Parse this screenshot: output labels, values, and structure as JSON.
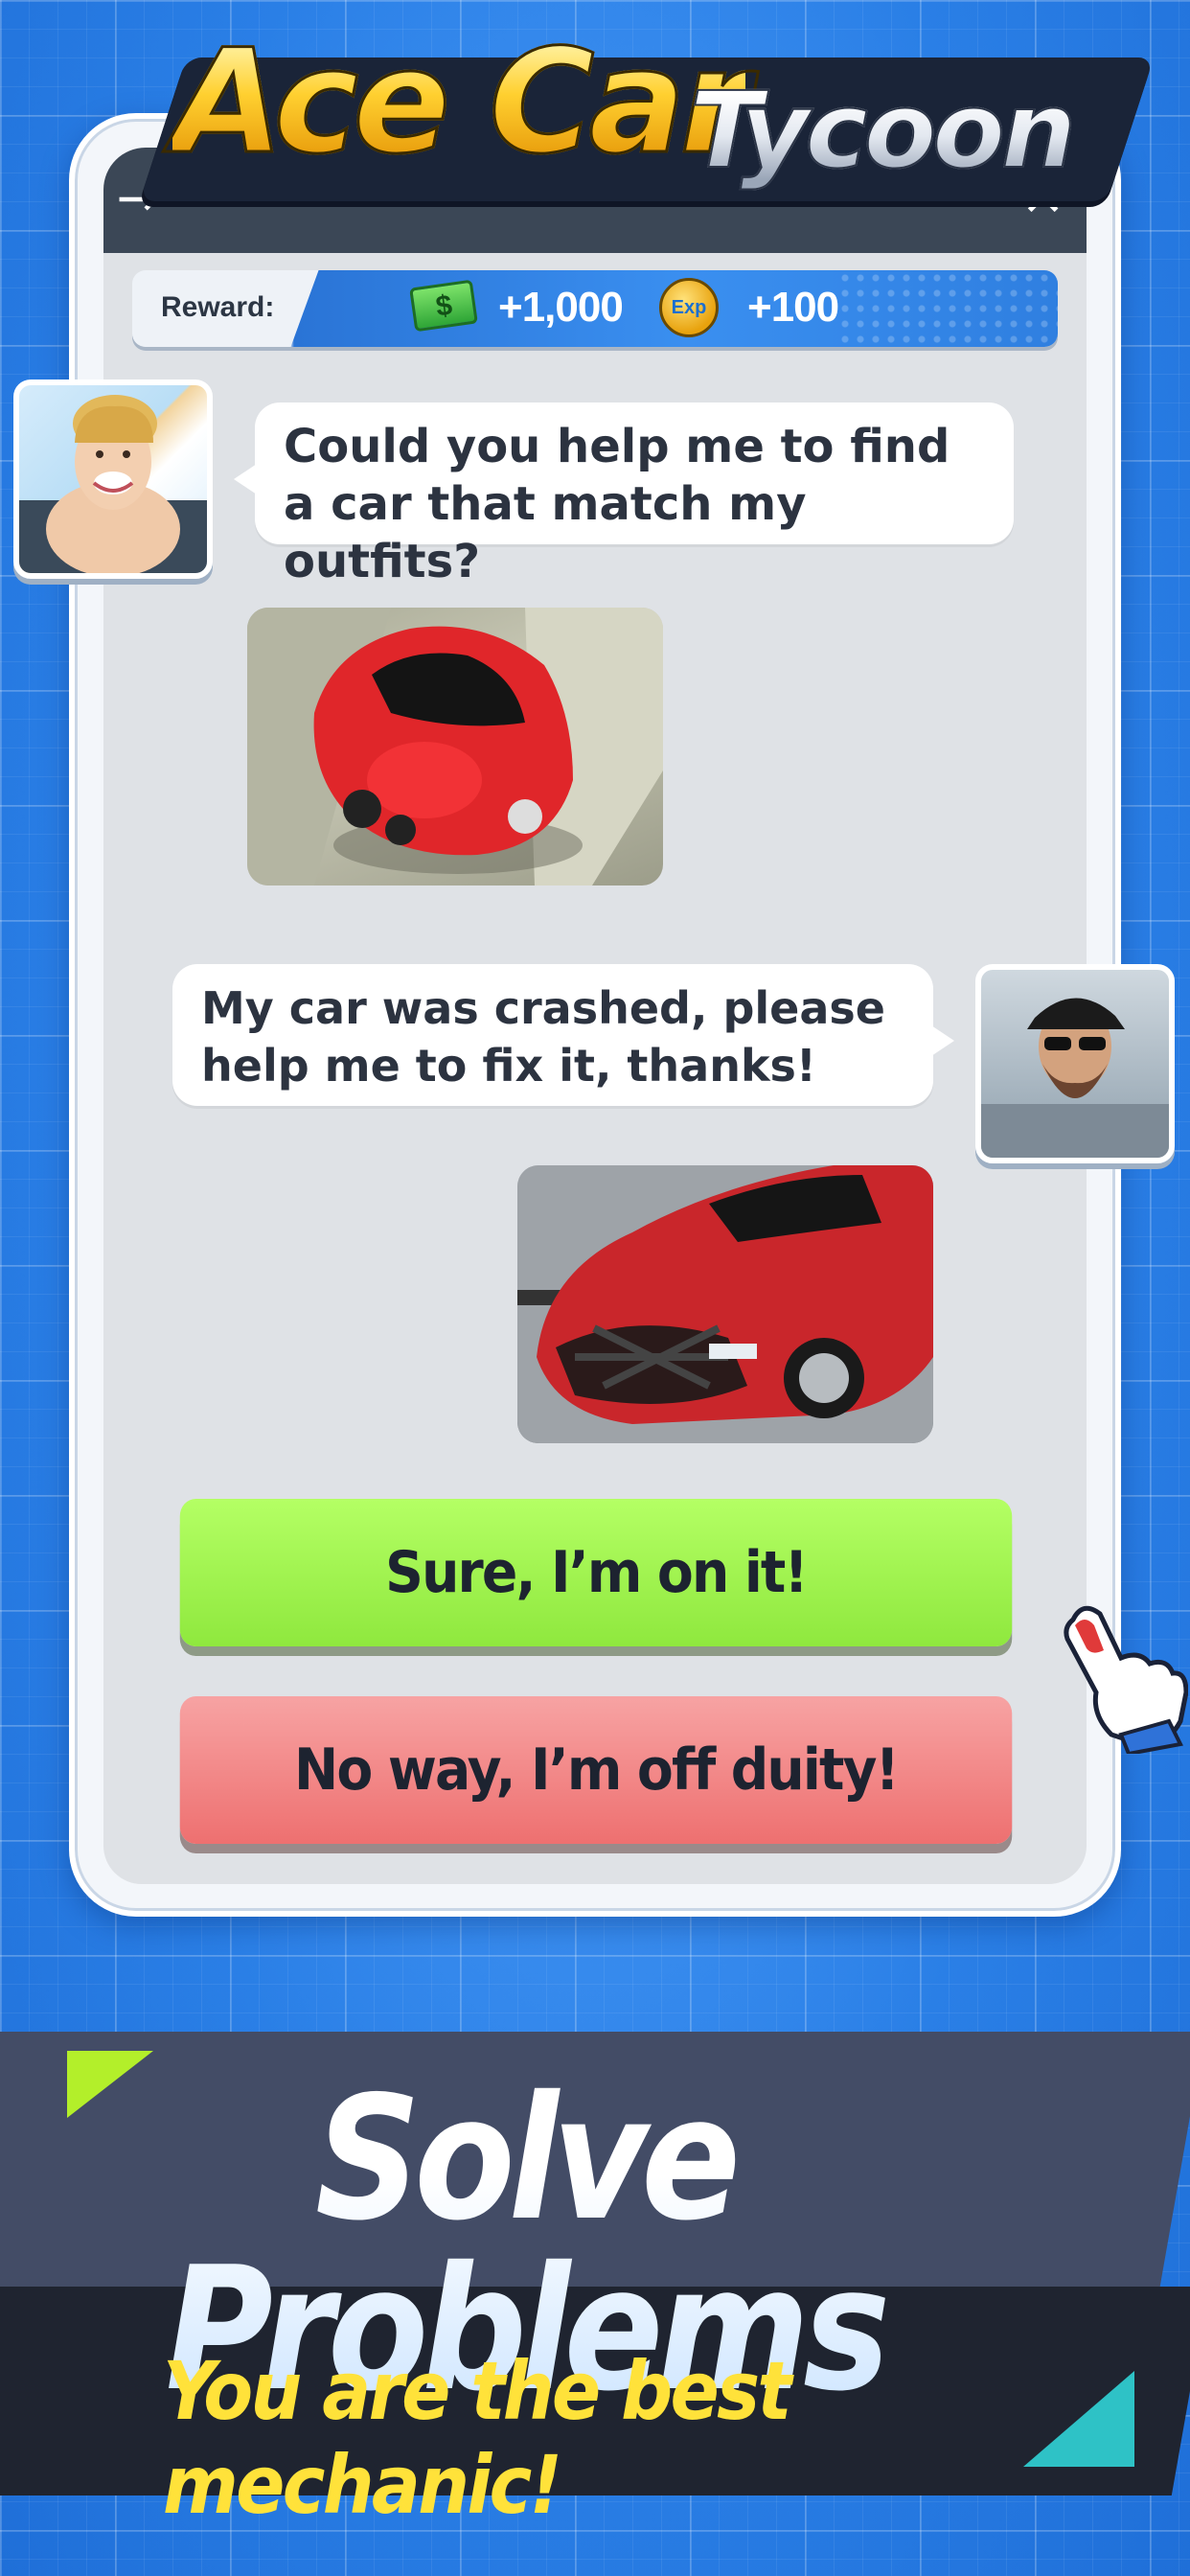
{
  "logo": {
    "word_1": "Ace Car",
    "word_2": "Tycoon"
  },
  "reward": {
    "label": "Reward:",
    "cash": "+1,000",
    "exp": "+100",
    "exp_badge": "Exp"
  },
  "chat": [
    {
      "sender": "woman",
      "text": "Could you help me to find a car that match my outfits?"
    },
    {
      "sender": "man",
      "text": "My car was crashed, please help me to fix it, thanks!"
    }
  ],
  "choices": {
    "accept": "Sure, I’m on it!",
    "decline": "No way, I’m off duity!"
  },
  "banner": {
    "headline": "Solve Problems",
    "subline": "You are the best mechanic!"
  },
  "colors": {
    "background": "#2f86ea",
    "accept": "#a3f553",
    "decline": "#f08080",
    "headline_plate": "#434c66",
    "subline_plate": "#1f2430",
    "subline_text": "#ffe23a"
  },
  "icons": [
    "back-icon",
    "close-icon",
    "cash-icon",
    "exp-icon",
    "hand-pointer-icon"
  ]
}
